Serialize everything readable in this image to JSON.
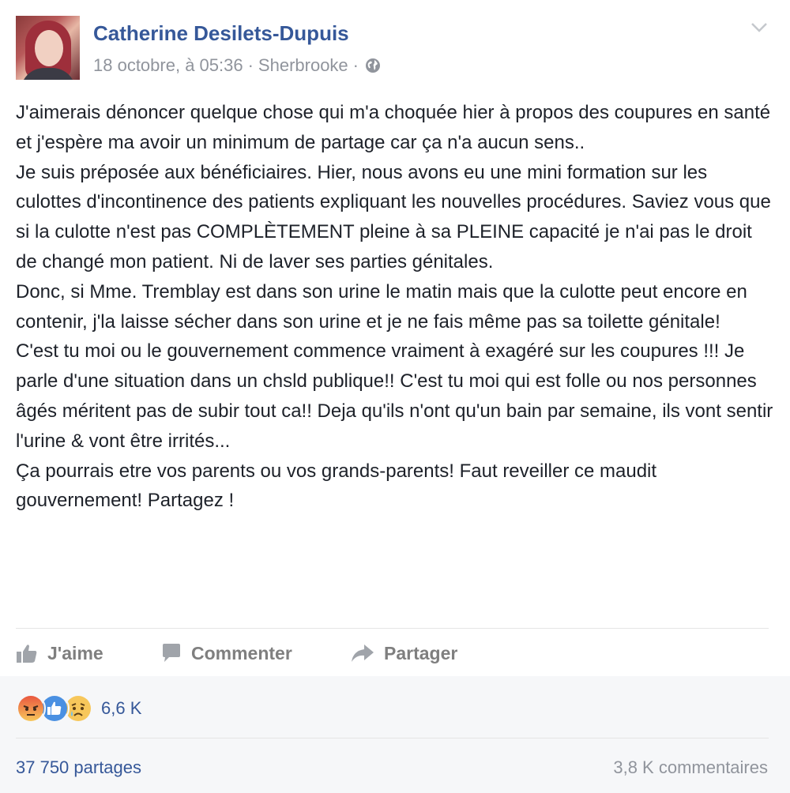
{
  "post": {
    "author": "Catherine Desilets-Dupuis",
    "date": "18 octobre, à 05:36",
    "separator": "·",
    "location": "Sherbrooke",
    "privacy_icon": "globe-icon",
    "menu_icon": "chevron-down-icon",
    "paragraphs": [
      "J'aimerais dénoncer quelque chose qui m'a choquée hier à propos des coupures en santé et j'espère ma avoir un minimum de partage car ça n'a aucun sens..",
      "Je suis préposée aux bénéficiaires. Hier, nous avons eu une mini formation sur les culottes d'incontinence des patients expliquant les nouvelles procédures. Saviez vous que si la culotte n'est pas COMPLÈTEMENT pleine à sa PLEINE capacité je n'ai pas le droit de changé mon patient. Ni de laver ses parties génitales.",
      "Donc, si Mme. Tremblay est dans son urine le matin mais que la culotte peut encore en contenir, j'la laisse sécher dans son urine et je ne fais même pas sa toilette génitale!",
      "C'est tu moi ou le gouvernement commence vraiment à exagéré sur les coupures !!! Je parle d'une situation dans un chsld publique!! C'est tu moi qui est folle ou nos personnes âgés méritent pas de subir tout ca!! Deja qu'ils n'ont qu'un bain par semaine, ils vont sentir l'urine & vont être irrités...",
      "Ça pourrais etre vos parents ou vos grands-parents! Faut reveiller ce maudit gouvernement! Partagez !"
    ]
  },
  "actions": {
    "like": "J'aime",
    "comment": "Commenter",
    "share": "Partager"
  },
  "reactions": {
    "icons": [
      "angry-reaction-icon",
      "like-reaction-icon",
      "sad-reaction-icon"
    ],
    "count": "6,6 K"
  },
  "stats": {
    "shares": "37 750 partages",
    "comments": "3,8 K commentaires"
  },
  "colors": {
    "link": "#365899",
    "muted": "#90949c",
    "text": "#1d2129",
    "footer_bg": "#f6f7f9"
  }
}
